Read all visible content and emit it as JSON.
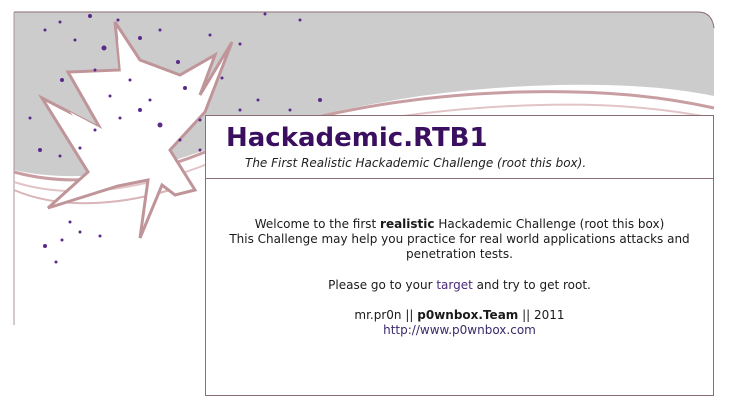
{
  "header": {
    "title": "Hackademic.RTB1",
    "subtitle": "The First Realistic Hackademic Challenge (root this box)."
  },
  "content": {
    "welcome_prefix": "Welcome to the first ",
    "welcome_bold": "realistic",
    "welcome_suffix": " Hackademic Challenge (root this box)",
    "line2": "This Challenge may help you practice for real world applications attacks and penetration tests.",
    "cta_prefix": "Please go to your ",
    "cta_link": "target",
    "cta_suffix": " and try to get root.",
    "credit_author": "mr.pr0n",
    "credit_sep1": " || ",
    "credit_team": "p0wnbox.Team",
    "credit_sep2": " || ",
    "credit_year": "2011",
    "url": "http://www.p0wnbox.com"
  },
  "colors": {
    "title": "#3a0f60",
    "banner_grey": "#cbcbcb",
    "stroke": "#c99ea2",
    "star_fill": "#ffffff",
    "dots": "#5a2a8a"
  },
  "icons": [
    "starburst-logo"
  ]
}
